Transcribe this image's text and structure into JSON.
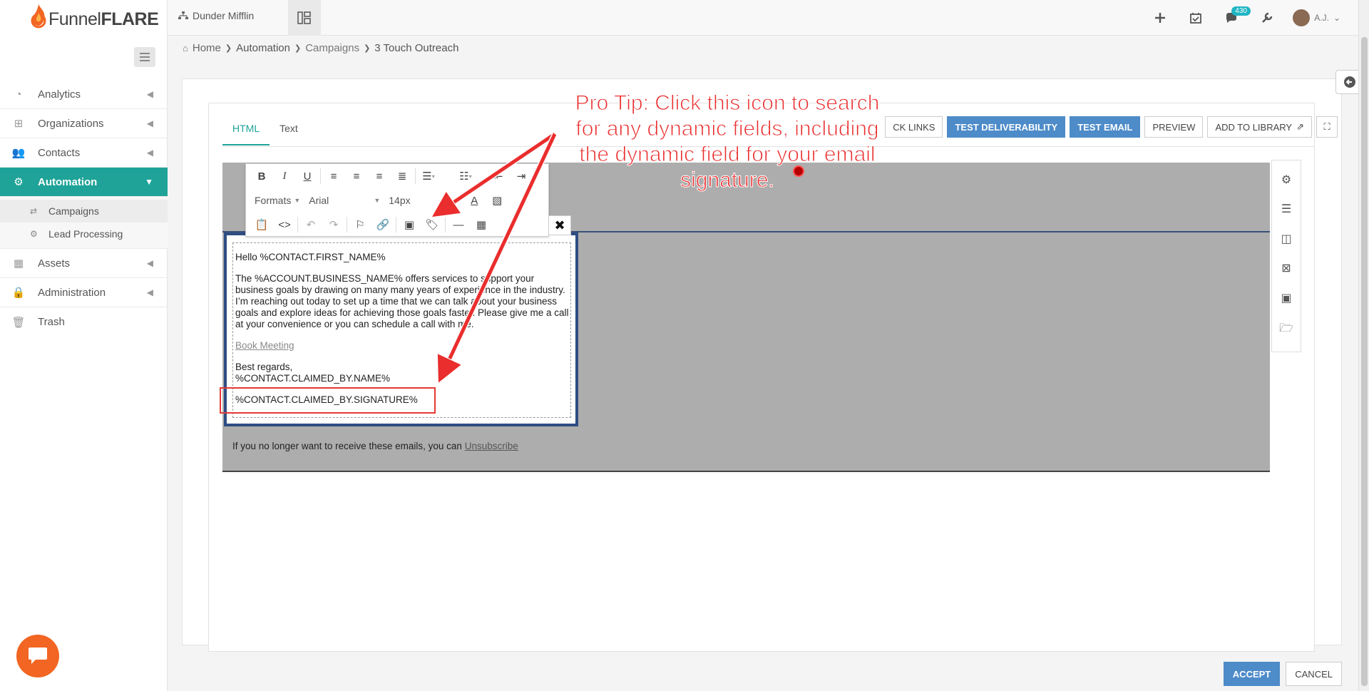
{
  "app": {
    "name_light": "Funnel",
    "name_bold": "FLARE"
  },
  "topbar": {
    "tenant": "Dunder Mifflin",
    "notifications_count": "430",
    "user_initials": "A.J."
  },
  "sidebar": {
    "items": [
      {
        "label": "Analytics",
        "icon": "dashboard-icon"
      },
      {
        "label": "Organizations",
        "icon": "sitemap-icon"
      },
      {
        "label": "Contacts",
        "icon": "users-icon"
      },
      {
        "label": "Automation",
        "icon": "gears-icon",
        "active": true
      },
      {
        "label": "Assets",
        "icon": "grid-icon"
      },
      {
        "label": "Administration",
        "icon": "lock-icon"
      },
      {
        "label": "Trash",
        "icon": "trash-icon"
      }
    ],
    "sub_items": [
      {
        "label": "Campaigns",
        "icon": "retweet-icon"
      },
      {
        "label": "Lead Processing",
        "icon": "cogs-icon"
      }
    ]
  },
  "breadcrumb": {
    "home": "Home",
    "automation": "Automation",
    "campaigns": "Campaigns",
    "current": "3 Touch Outreach"
  },
  "editor": {
    "tabs": [
      "HTML",
      "Text"
    ],
    "actions": {
      "check_links": "CK LINKS",
      "test_deliverability": "TEST DELIVERABILITY",
      "test_email": "TEST EMAIL",
      "preview": "PREVIEW",
      "add_to_library": "ADD TO LIBRARY"
    },
    "toolbar": {
      "formats": "Formats",
      "font": "Arial",
      "size": "14px"
    }
  },
  "email": {
    "greeting": "Hello %CONTACT.FIRST_NAME%",
    "body": "The %ACCOUNT.BUSINESS_NAME% offers services to support your business goals by drawing on many many years of experience in the industry. I’m reaching out today to set up a time that we can talk about your business goals and explore ideas for achieving those goals faster. Please give me a call at your convenience or you can schedule a call with me.",
    "link": "Book Meeting",
    "closing": "Best regards,",
    "sender": "%CONTACT.CLAIMED_BY.NAME%",
    "signature": "%CONTACT.CLAIMED_BY.SIGNATURE%",
    "unsubscribe_text": "If you no longer want to receive these emails, you can",
    "unsubscribe_link": "Unsubscribe"
  },
  "annotation": {
    "line1": "Pro Tip: Click this icon to search",
    "line2": "for any dynamic fields, including",
    "line3": "the dynamic field for your email",
    "line4": "signature."
  },
  "footer": {
    "accept": "ACCEPT",
    "cancel": "CANCEL"
  },
  "colors": {
    "accent": "#1fa398",
    "primary_button": "#4d8bc9",
    "annotation": "#ea2d2d",
    "chat": "#f26522"
  }
}
